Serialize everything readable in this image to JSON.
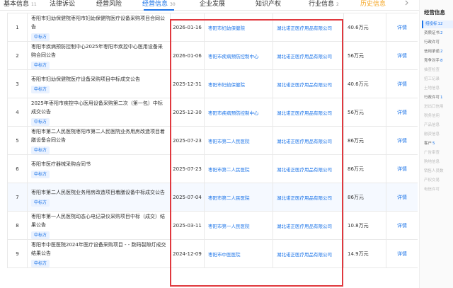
{
  "tabs": [
    {
      "label": "基本信息",
      "count": "11"
    },
    {
      "label": "法律诉讼",
      "count": ""
    },
    {
      "label": "经营风险",
      "count": ""
    },
    {
      "label": "经营信息",
      "count": "30"
    },
    {
      "label": "企业发展",
      "count": ""
    },
    {
      "label": "知识产权",
      "count": ""
    },
    {
      "label": "行业信息",
      "count": "2"
    },
    {
      "label": "历史信息",
      "count": ""
    }
  ],
  "tab_more_icon": "chevron-right-icon",
  "rows": [
    {
      "index": "1",
      "title": "枣阳市妇幼保健院枣阳市妇幼保健院医疗设备采购项目合同公告",
      "tag": "中标方",
      "date": "2026-01-16",
      "buyer": "枣阳市妇幼保健院",
      "supplier": "湖北诺正医疗用品有限公司",
      "amount": "40.6万元",
      "detail": "详情"
    },
    {
      "index": "2",
      "title": "枣阳市疾病预防控制中心2025年枣阳市疾控中心医用设备采购合同公告",
      "tag": "中标方",
      "date": "2026-01-06",
      "buyer": "枣阳市疾病预防控制中心",
      "supplier": "湖北诺正医疗用品有限公司",
      "amount": "56万元",
      "detail": "详情"
    },
    {
      "index": "3",
      "title": "枣阳市妇幼保健院医疗设备采购项目中标成交公告",
      "tag": "中标方",
      "date": "2025-12-31",
      "buyer": "枣阳市妇幼保健院",
      "supplier": "湖北诺正医疗用品有限公司",
      "amount": "40.6万元",
      "detail": "详情"
    },
    {
      "index": "4",
      "title": "2025年枣阳市疾控中心医用设备采购第二次（第一包）中标成交公告",
      "tag": "中标方",
      "date": "2025-12-30",
      "buyer": "枣阳市疾病预防控制中心",
      "supplier": "湖北诺正医疗用品有限公司",
      "amount": "56万元",
      "detail": "详情"
    },
    {
      "index": "5",
      "title": "枣阳市第二人民医院枣阳市第二人民医院业务用房改造项目着膳设备合同公告",
      "tag": "中标方",
      "date": "2025-07-23",
      "buyer": "枣阳市第二人民医院",
      "supplier": "湖北诺正医疗用品有限公司",
      "amount": "86万元",
      "detail": "详情"
    },
    {
      "index": "6",
      "title": "枣阳市医疗器械采购合同书",
      "tag": "中标方",
      "date": "2025-07-23",
      "buyer": "枣阳市第二人民医院",
      "supplier": "湖北诺正医疗用品有限公司",
      "amount": "86万元",
      "detail": "详情"
    },
    {
      "index": "7",
      "title": "枣阳市第二人民医院业务用房改造项目着膳设备中标成交公告",
      "tag": "中标方",
      "date": "2025-07-04",
      "buyer": "枣阳市第二人民医院",
      "supplier": "湖北诺正医疗用品有限公司",
      "amount": "86万元",
      "detail": "详情"
    },
    {
      "index": "8",
      "title": "枣阳市第一人民医院动态心电记录仪采购项目中标（成交）结果公告",
      "tag": "中标方",
      "date": "2025-03-11",
      "buyer": "枣阳市第一人民医院",
      "supplier": "湖北诺正医疗用品有限公司",
      "amount": "10.8万元",
      "detail": "详情"
    },
    {
      "index": "9",
      "title": "枣阳市中医医院2024年医疗设备采购项目 - - 数码裂隙灯成交结果公告",
      "tag": "中标方",
      "date": "2024-12-09",
      "buyer": "枣阳市中医医院",
      "supplier": "湖北诺正医疗用品有限公司",
      "amount": "14.9万元",
      "detail": "详情"
    }
  ],
  "rightnav": {
    "title": "经营信息",
    "items": [
      {
        "label": "招投标",
        "count": "12",
        "state": "active"
      },
      {
        "label": "资质证书",
        "count": "2",
        "state": "normal"
      },
      {
        "label": "行政许可",
        "count": "",
        "state": "normal"
      },
      {
        "label": "信用承诺",
        "count": "2",
        "state": "normal"
      },
      {
        "label": "竞争对手",
        "count": "8",
        "state": "normal"
      },
      {
        "label": "抽查检查",
        "count": "",
        "state": "disabled"
      },
      {
        "label": "招工记录",
        "count": "",
        "state": "disabled"
      },
      {
        "label": "土地信息",
        "count": "",
        "state": "disabled"
      },
      {
        "label": "行政许可",
        "count": "1",
        "state": "normal"
      },
      {
        "label": "进出口信用",
        "count": "",
        "state": "disabled"
      },
      {
        "label": "税务信用",
        "count": "",
        "state": "disabled"
      },
      {
        "label": "产品信息",
        "count": "",
        "state": "disabled"
      },
      {
        "label": "融资信息",
        "count": "",
        "state": "disabled"
      },
      {
        "label": "客户",
        "count": "5",
        "state": "normal"
      },
      {
        "label": "广告审查",
        "count": "",
        "state": "disabled"
      },
      {
        "label": "购地信息",
        "count": "",
        "state": "disabled"
      },
      {
        "label": "销售人员数",
        "count": "",
        "state": "disabled"
      },
      {
        "label": "产权交易",
        "count": "",
        "state": "disabled"
      },
      {
        "label": "电信许可",
        "count": "",
        "state": "disabled"
      }
    ]
  },
  "colors": {
    "accent": "#1a73e8",
    "highlight_border": "#e0383e",
    "tag_bg": "#eaf2ff"
  }
}
